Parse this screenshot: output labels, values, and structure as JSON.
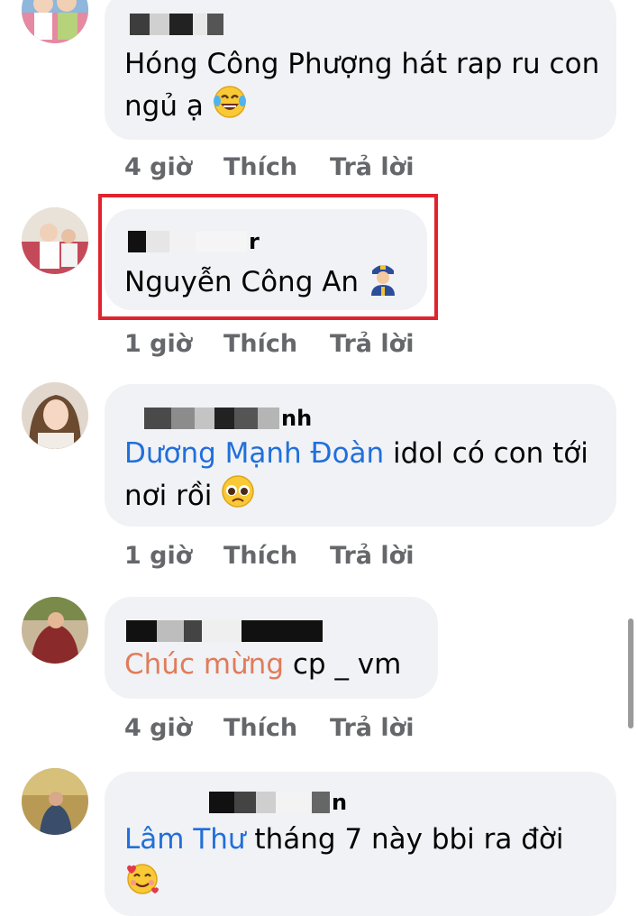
{
  "comments": [
    {
      "name_tail": "",
      "text": "Hóng Công Phượng hát rap ru con ngủ ạ",
      "emoji": "tears-of-joy-emoji",
      "time": "4 giờ",
      "like": "Thích",
      "reply": "Trả lời"
    },
    {
      "name_tail": "r",
      "text": "Nguyễn Công An",
      "emoji": "police-officer-emoji",
      "time": "1 giờ",
      "like": "Thích",
      "reply": "Trả lời"
    },
    {
      "name_tail": "nh",
      "tag": "Dương Mạnh Đoàn",
      "text": " idol có con tới nơi rồi",
      "emoji": "pleading-face-emoji",
      "time": "1 giờ",
      "like": "Thích",
      "reply": "Trả lời"
    },
    {
      "name_tail": "",
      "tag": "Chúc mừng",
      "text": " cp _ vm",
      "time": "4 giờ",
      "like": "Thích",
      "reply": "Trả lời"
    },
    {
      "name_tail": "n",
      "tag": "Lâm Thư",
      "text": " tháng 7 này bbi ra đời",
      "emoji": "smiling-face-with-hearts-emoji"
    }
  ],
  "colors": {
    "mention_blue": "#216fdb",
    "mention_orange": "#e07c5a",
    "highlight_red": "#e0242f",
    "bubble_bg": "#f0f2f5",
    "meta_gray": "#65676b"
  }
}
